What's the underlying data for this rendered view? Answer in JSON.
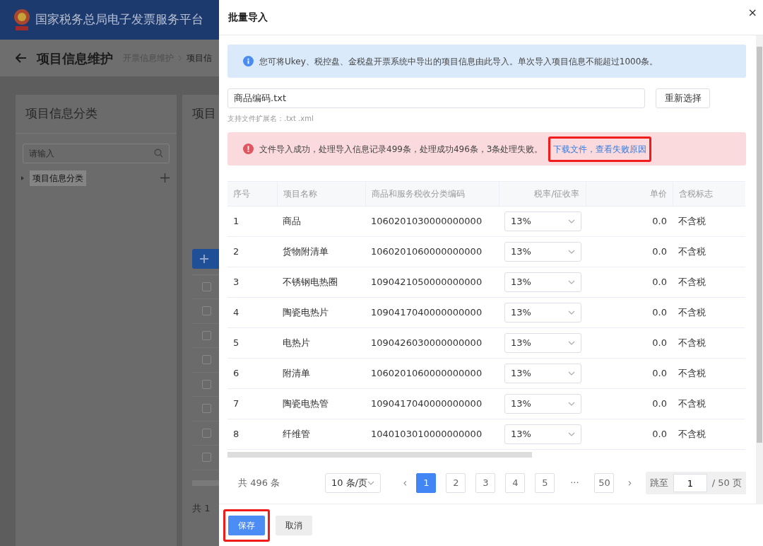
{
  "header": {
    "title": "国家税务总局电子发票服务平台"
  },
  "page": {
    "title": "项目信息维护",
    "breadcrumb": [
      {
        "label": "开票信息维护"
      },
      {
        "label": "项目信"
      }
    ]
  },
  "sidebar": {
    "title": "项目信息分类",
    "search": {
      "placeholder": "请输入"
    },
    "tree": [
      {
        "label": "项目信息分类",
        "expanded": false,
        "selected": true
      }
    ]
  },
  "main_panel": {
    "title": "项目",
    "rows": [
      {
        "checked": false
      },
      {
        "checked": false
      },
      {
        "checked": false
      },
      {
        "checked": false
      },
      {
        "checked": false
      },
      {
        "checked": false
      },
      {
        "checked": false
      },
      {
        "checked": false
      }
    ],
    "footer_text": "共 1"
  },
  "dialog": {
    "title": "批量导入",
    "close": "×",
    "info": "您可将Ukey、税控盘、金税盘开票系统中导出的项目信息由此导入。单次导入项目信息不能超过1000条。",
    "file": {
      "value": "商品编码.txt",
      "button": "重新选择",
      "hint": "支持文件扩展名：.txt .xml"
    },
    "error": {
      "message": "文件导入成功，处理导入信息记录499条，处理成功496条，3条处理失败。",
      "link": "下载文件，查看失败原因",
      "highlighted": true
    },
    "table": {
      "columns": [
        {
          "label": "序号"
        },
        {
          "label": "项目名称"
        },
        {
          "label": "商品和服务税收分类编码"
        },
        {
          "label": "税率/征收率"
        },
        {
          "label": "单价"
        },
        {
          "label": "含税标志"
        }
      ],
      "rows": [
        [
          "1",
          "商品",
          "1060201030000000000",
          "13%",
          "0.0",
          "不含税"
        ],
        [
          "2",
          "货物附清单",
          "1060201060000000000",
          "13%",
          "0.0",
          "不含税"
        ],
        [
          "3",
          "不锈钢电热圈",
          "1090421050000000000",
          "13%",
          "0.0",
          "不含税"
        ],
        [
          "4",
          "陶瓷电热片",
          "1090417040000000000",
          "13%",
          "0.0",
          "不含税"
        ],
        [
          "5",
          "电热片",
          "1090426030000000000",
          "13%",
          "0.0",
          "不含税"
        ],
        [
          "6",
          "附清单",
          "1060201060000000000",
          "13%",
          "0.0",
          "不含税"
        ],
        [
          "7",
          "陶瓷电热管",
          "1090417040000000000",
          "13%",
          "0.0",
          "不含税"
        ],
        [
          "8",
          "纤维管",
          "1040103010000000000",
          "13%",
          "0.0",
          "不含税"
        ]
      ]
    },
    "pagination": {
      "total": "共 496 条",
      "page_size": "10 条/页",
      "prev": "‹",
      "next": "›",
      "pages": [
        {
          "label": "1",
          "selected": true
        },
        {
          "label": "2",
          "selected": false
        },
        {
          "label": "3",
          "selected": false
        },
        {
          "label": "4",
          "selected": false
        },
        {
          "label": "5",
          "selected": false
        },
        {
          "label": "···",
          "selected": false
        },
        {
          "label": "50",
          "selected": false
        }
      ],
      "jump_label": "跳至",
      "jump_value": "1",
      "page_total": "/ 50 页"
    },
    "buttons": [
      {
        "label": "保存",
        "kind": "primary",
        "highlighted": true
      },
      {
        "label": "取消",
        "kind": "secondary",
        "highlighted": false
      }
    ]
  }
}
